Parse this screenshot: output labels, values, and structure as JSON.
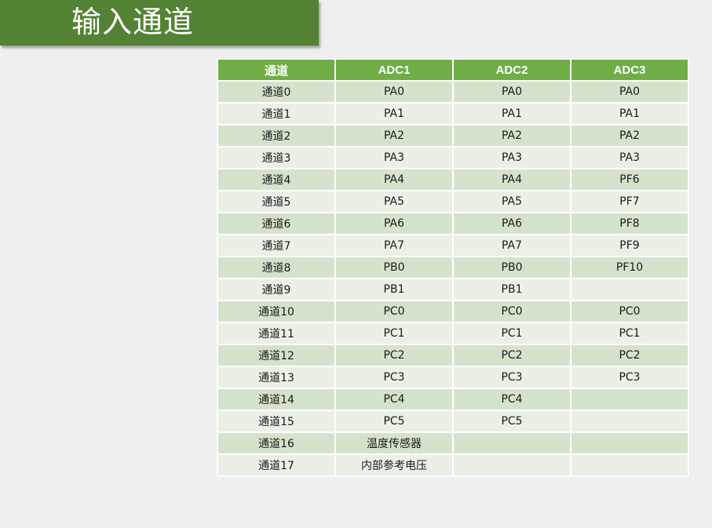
{
  "title": "输入通道",
  "table": {
    "headers": [
      "通道",
      "ADC1",
      "ADC2",
      "ADC3"
    ],
    "rows": [
      [
        "通道0",
        "PA0",
        "PA0",
        "PA0"
      ],
      [
        "通道1",
        "PA1",
        "PA1",
        "PA1"
      ],
      [
        "通道2",
        "PA2",
        "PA2",
        "PA2"
      ],
      [
        "通道3",
        "PA3",
        "PA3",
        "PA3"
      ],
      [
        "通道4",
        "PA4",
        "PA4",
        "PF6"
      ],
      [
        "通道5",
        "PA5",
        "PA5",
        "PF7"
      ],
      [
        "通道6",
        "PA6",
        "PA6",
        "PF8"
      ],
      [
        "通道7",
        "PA7",
        "PA7",
        "PF9"
      ],
      [
        "通道8",
        "PB0",
        "PB0",
        "PF10"
      ],
      [
        "通道9",
        "PB1",
        "PB1",
        ""
      ],
      [
        "通道10",
        "PC0",
        "PC0",
        "PC0"
      ],
      [
        "通道11",
        "PC1",
        "PC1",
        "PC1"
      ],
      [
        "通道12",
        "PC2",
        "PC2",
        "PC2"
      ],
      [
        "通道13",
        "PC3",
        "PC3",
        "PC3"
      ],
      [
        "通道14",
        "PC4",
        "PC4",
        ""
      ],
      [
        "通道15",
        "PC5",
        "PC5",
        ""
      ],
      [
        "通道16",
        "温度传感器",
        "",
        ""
      ],
      [
        "通道17",
        "内部参考电压",
        "",
        ""
      ]
    ]
  }
}
